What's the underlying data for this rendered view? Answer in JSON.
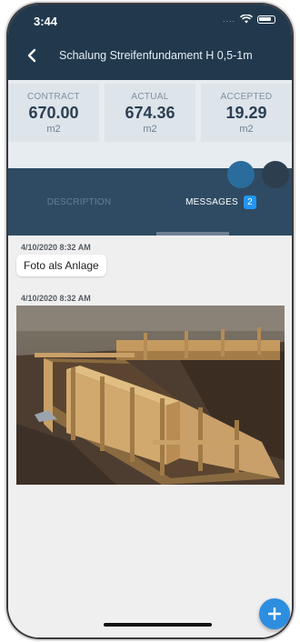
{
  "status_bar": {
    "time": "3:44",
    "signal": "....",
    "wifi_icon": "wifi-icon",
    "battery_icon": "battery-icon"
  },
  "header": {
    "back_icon": "chevron-left-icon",
    "title": "Schalung Streifenfundament H 0,5-1m"
  },
  "metrics": [
    {
      "label": "CONTRACT",
      "value": "670.00",
      "unit": "m2"
    },
    {
      "label": "ACTUAL",
      "value": "674.36",
      "unit": "m2"
    },
    {
      "label": "ACCEPTED",
      "value": "19.29",
      "unit": "m2"
    }
  ],
  "tabs": {
    "description_label": "DESCRIPTION",
    "messages_label": "MESSAGES",
    "messages_count": "2",
    "active": "MESSAGES"
  },
  "messages": [
    {
      "timestamp": "4/10/2020 8:32 AM",
      "text": "Foto als Anlage"
    },
    {
      "timestamp": "4/10/2020 8:32 AM",
      "image": "photo-construction-formwork"
    }
  ],
  "fab": {
    "icon": "plus-icon"
  },
  "colors": {
    "header_bg": "#22394d",
    "tabs_bg": "#2f4b63",
    "accent": "#2196f3",
    "fab": "#2d8ee0"
  }
}
